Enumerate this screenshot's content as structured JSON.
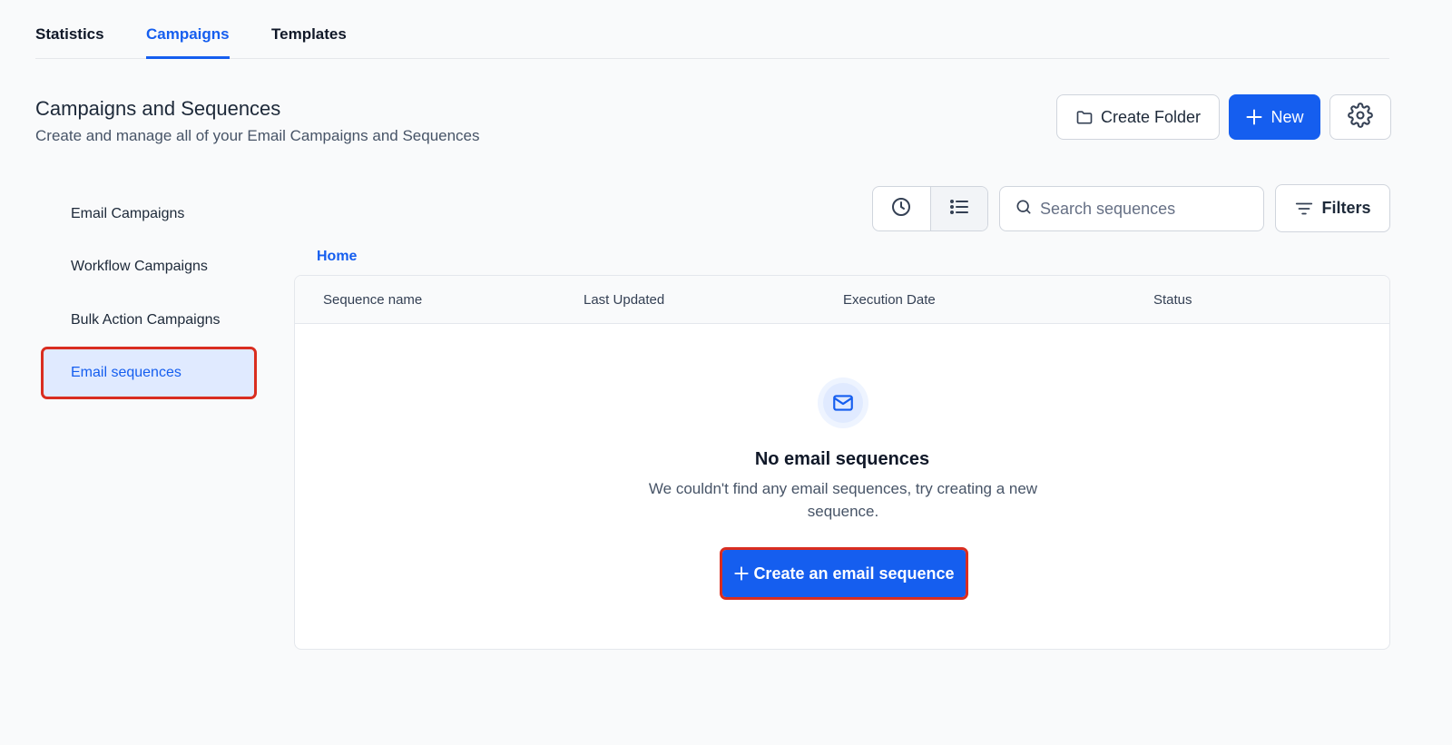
{
  "tabs": [
    {
      "label": "Statistics",
      "active": false
    },
    {
      "label": "Campaigns",
      "active": true
    },
    {
      "label": "Templates",
      "active": false
    }
  ],
  "header": {
    "title": "Campaigns and Sequences",
    "subtitle": "Create and manage all of your Email Campaigns and Sequences",
    "create_folder_label": "Create Folder",
    "new_label": "New"
  },
  "subnav": {
    "items": [
      {
        "label": "Email Campaigns",
        "active": false
      },
      {
        "label": "Workflow Campaigns",
        "active": false
      },
      {
        "label": "Bulk Action Campaigns",
        "active": false
      },
      {
        "label": "Email sequences",
        "active": true
      }
    ]
  },
  "toolbar": {
    "search_placeholder": "Search sequences",
    "filters_label": "Filters"
  },
  "breadcrumb": "Home",
  "table": {
    "columns": [
      "Sequence name",
      "Last Updated",
      "Execution Date",
      "Status"
    ],
    "empty": {
      "title": "No email sequences",
      "description": "We couldn't find any email sequences, try creating a new sequence.",
      "button_label": "Create an email sequence"
    }
  },
  "colors": {
    "accent": "#155eef",
    "highlight_border": "#d92d20"
  },
  "icons": [
    "folder-icon",
    "plus-icon",
    "gear-icon",
    "clock-icon",
    "list-icon",
    "search-icon",
    "filter-icon",
    "mail-icon"
  ]
}
